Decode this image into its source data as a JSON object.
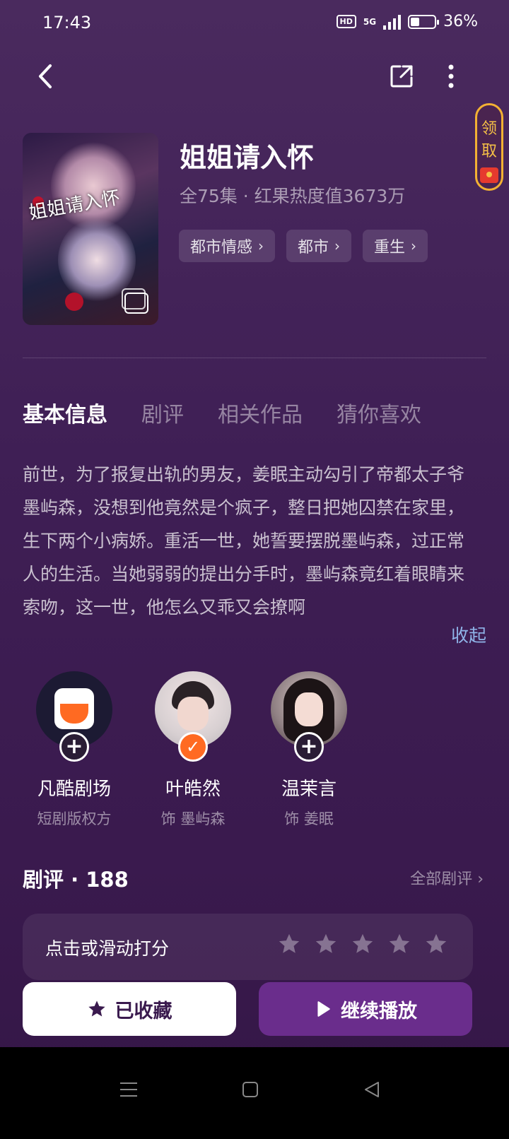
{
  "status": {
    "time": "17:43",
    "hd": "HD",
    "network": "5G",
    "battery": "36%",
    "battery_level": 0.36
  },
  "topbar": {
    "back_icon": "chevron-left-icon",
    "share_icon": "share-icon",
    "more_icon": "more-vertical-icon"
  },
  "claim_badge": {
    "line1": "领",
    "line2": "取",
    "icon": "red-envelope-icon",
    "color": "#f3b133"
  },
  "drama": {
    "poster_title": "姐姐请入怀",
    "title": "姐姐请入怀",
    "meta": "全75集 · 红果热度值3673万",
    "tags": [
      "都市情感",
      "都市",
      "重生"
    ]
  },
  "tabs": [
    "基本信息",
    "剧评",
    "相关作品",
    "猜你喜欢"
  ],
  "active_tab": 0,
  "description": "前世，为了报复出轨的男友，姜眠主动勾引了帝都太子爷墨屿森，没想到他竟然是个疯子，整日把她囚禁在家里，生下两个小病娇。重活一世，她誓要摆脱墨屿森，过正常人的生活。当她弱弱的提出分手时，墨屿森竟红着眼睛来索吻，这一世，他怎么又乖又会撩啊",
  "collapse_label": "收起",
  "cast": [
    {
      "name": "凡酷剧场",
      "role": "短剧版权方",
      "followed": false
    },
    {
      "name": "叶皓然",
      "role": "饰 墨屿森",
      "followed": true
    },
    {
      "name": "温茉言",
      "role": "饰 姜眠",
      "followed": false
    }
  ],
  "reviews": {
    "title": "剧评 · 188",
    "all_label": "全部剧评",
    "rating_prompt": "点击或滑动打分",
    "star_count": 5
  },
  "actions": {
    "favorite_label": "已收藏",
    "play_label": "继续播放",
    "favorite_icon": "star-icon",
    "play_icon": "play-icon"
  },
  "colors": {
    "accent_orange": "#ff6a22",
    "play_button": "#6a2d8c",
    "link_blue": "#8fb4e8"
  }
}
